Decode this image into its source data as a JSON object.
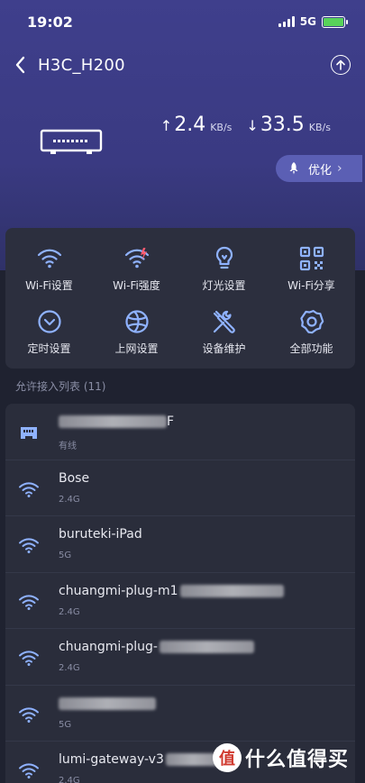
{
  "status": {
    "time": "19:02",
    "network": "5G"
  },
  "nav": {
    "title": "H3C_H200"
  },
  "speed": {
    "upload_value": "2.4",
    "upload_unit": "KB/s",
    "download_value": "33.5",
    "download_unit": "KB/s"
  },
  "optimize": {
    "label": "优化"
  },
  "functions": [
    {
      "label": "Wi-Fi设置",
      "icon": "wifi-icon"
    },
    {
      "label": "Wi-Fi强度",
      "icon": "wifi-strength-icon"
    },
    {
      "label": "灯光设置",
      "icon": "bulb-icon"
    },
    {
      "label": "Wi-Fi分享",
      "icon": "qr-code-icon"
    },
    {
      "label": "定时设置",
      "icon": "clock-icon"
    },
    {
      "label": "上网设置",
      "icon": "globe-icon"
    },
    {
      "label": "设备维护",
      "icon": "tools-icon"
    },
    {
      "label": "全部功能",
      "icon": "gear-icon"
    }
  ],
  "section": {
    "title": "允许接入列表 (11)"
  },
  "devices": [
    {
      "name": "F",
      "sub": "有线",
      "icon": "ethernet-icon"
    },
    {
      "name": "Bose",
      "sub": "2.4G",
      "icon": "wifi-icon"
    },
    {
      "name": "buruteki-iPad",
      "sub": "5G",
      "icon": "wifi-icon"
    },
    {
      "name": "chuangmi-plug-m1",
      "sub": "2.4G",
      "icon": "wifi-icon"
    },
    {
      "name": "chuangmi-plug-",
      "sub": "2.4G",
      "icon": "wifi-icon"
    },
    {
      "name": "",
      "sub": "5G",
      "icon": "wifi-icon"
    },
    {
      "name": "lumi-gateway-v3",
      "sub": "2.4G",
      "icon": "wifi-icon"
    }
  ],
  "watermark": {
    "text": "什么值得买",
    "logo_char": "值"
  },
  "colors": {
    "accent": "#8fb2ff",
    "header": "#3f3f8c",
    "card": "#2c2f3e",
    "battery": "#58d25a"
  }
}
